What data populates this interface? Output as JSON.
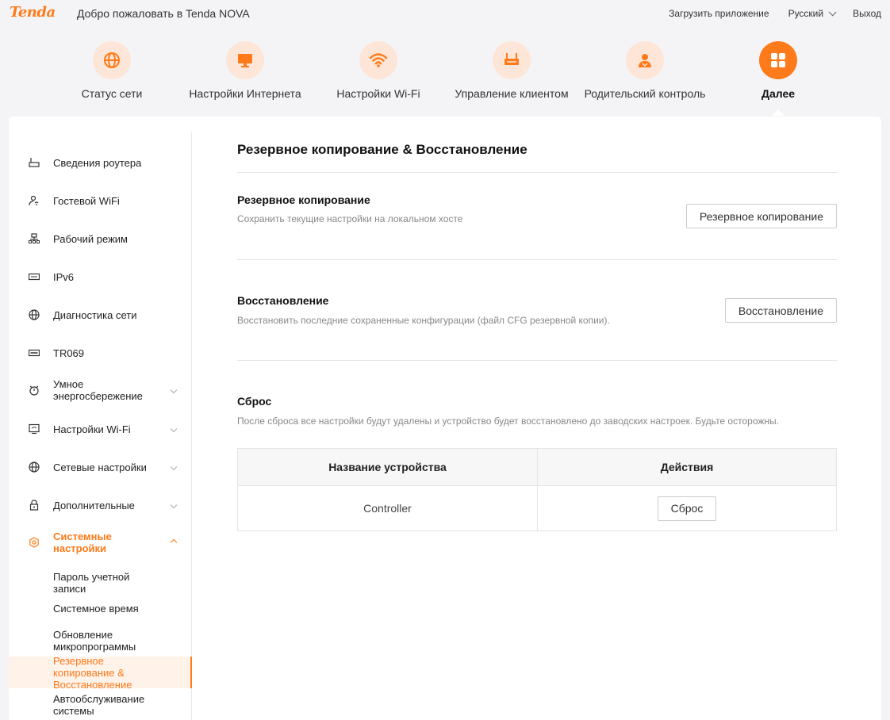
{
  "brand": {
    "logo": "Tenda",
    "welcome": "Добро пожаловать в Tenda NOVA",
    "accent": "#ff7a1a"
  },
  "top_links": {
    "download_app": "Загрузить приложение",
    "language": "Русский",
    "logout": "Выход"
  },
  "main_nav": [
    {
      "label": "Статус сети",
      "icon": "globe-icon"
    },
    {
      "label": "Настройки Интернета",
      "icon": "monitor-icon"
    },
    {
      "label": "Настройки Wi-Fi",
      "icon": "wifi-icon"
    },
    {
      "label": "Управление клиентом",
      "icon": "router-icon"
    },
    {
      "label": "Родительский контроль",
      "icon": "parental-icon"
    },
    {
      "label": "Далее",
      "icon": "grid-icon",
      "active": true
    }
  ],
  "sidebar": {
    "items": [
      {
        "label": "Сведения роутера",
        "icon": "router-icon"
      },
      {
        "label": "Гостевой WiFi",
        "icon": "guest-icon"
      },
      {
        "label": "Рабочий режим",
        "icon": "network-tree-icon"
      },
      {
        "label": "IPv6",
        "icon": "ipv6-icon"
      },
      {
        "label": "Диагностика сети",
        "icon": "globe-icon"
      },
      {
        "label": "TR069",
        "icon": "tr069-icon"
      },
      {
        "label": "Умное энергосбережение",
        "icon": "alarm-icon"
      },
      {
        "label": "Настройки Wi-Fi",
        "icon": "wifi-settings-icon"
      },
      {
        "label": "Сетевые настройки",
        "icon": "globe-icon"
      },
      {
        "label": "Дополнительные",
        "icon": "lock-icon"
      },
      {
        "label": "Системные настройки",
        "icon": "gear-icon"
      }
    ],
    "sub_items": [
      {
        "label": "Пароль учетной записи"
      },
      {
        "label": "Системное время"
      },
      {
        "label": "Обновление микропрограммы"
      },
      {
        "label": "Резервное копирование & Восстановление",
        "active": true
      },
      {
        "label": "Автообслуживание системы"
      }
    ]
  },
  "content": {
    "title": "Резервное копирование & Восстановление",
    "backup": {
      "title": "Резервное копирование",
      "desc": "Сохранить текущие настройки на локальном хосте",
      "button": "Резервное копирование"
    },
    "restore": {
      "title": "Восстановление",
      "desc": "Восстановить последние сохраненные конфигурации (файл CFG резервной копии).",
      "button": "Восстановление"
    },
    "reset": {
      "title": "Сброс",
      "desc": "После сброса все настройки будут удалены и устройство будет восстановлено до заводских настроек. Будьте осторожны.",
      "columns": [
        "Название устройства",
        "Действия"
      ],
      "rows": [
        {
          "device": "Controller",
          "action": "Сброс"
        }
      ]
    }
  }
}
